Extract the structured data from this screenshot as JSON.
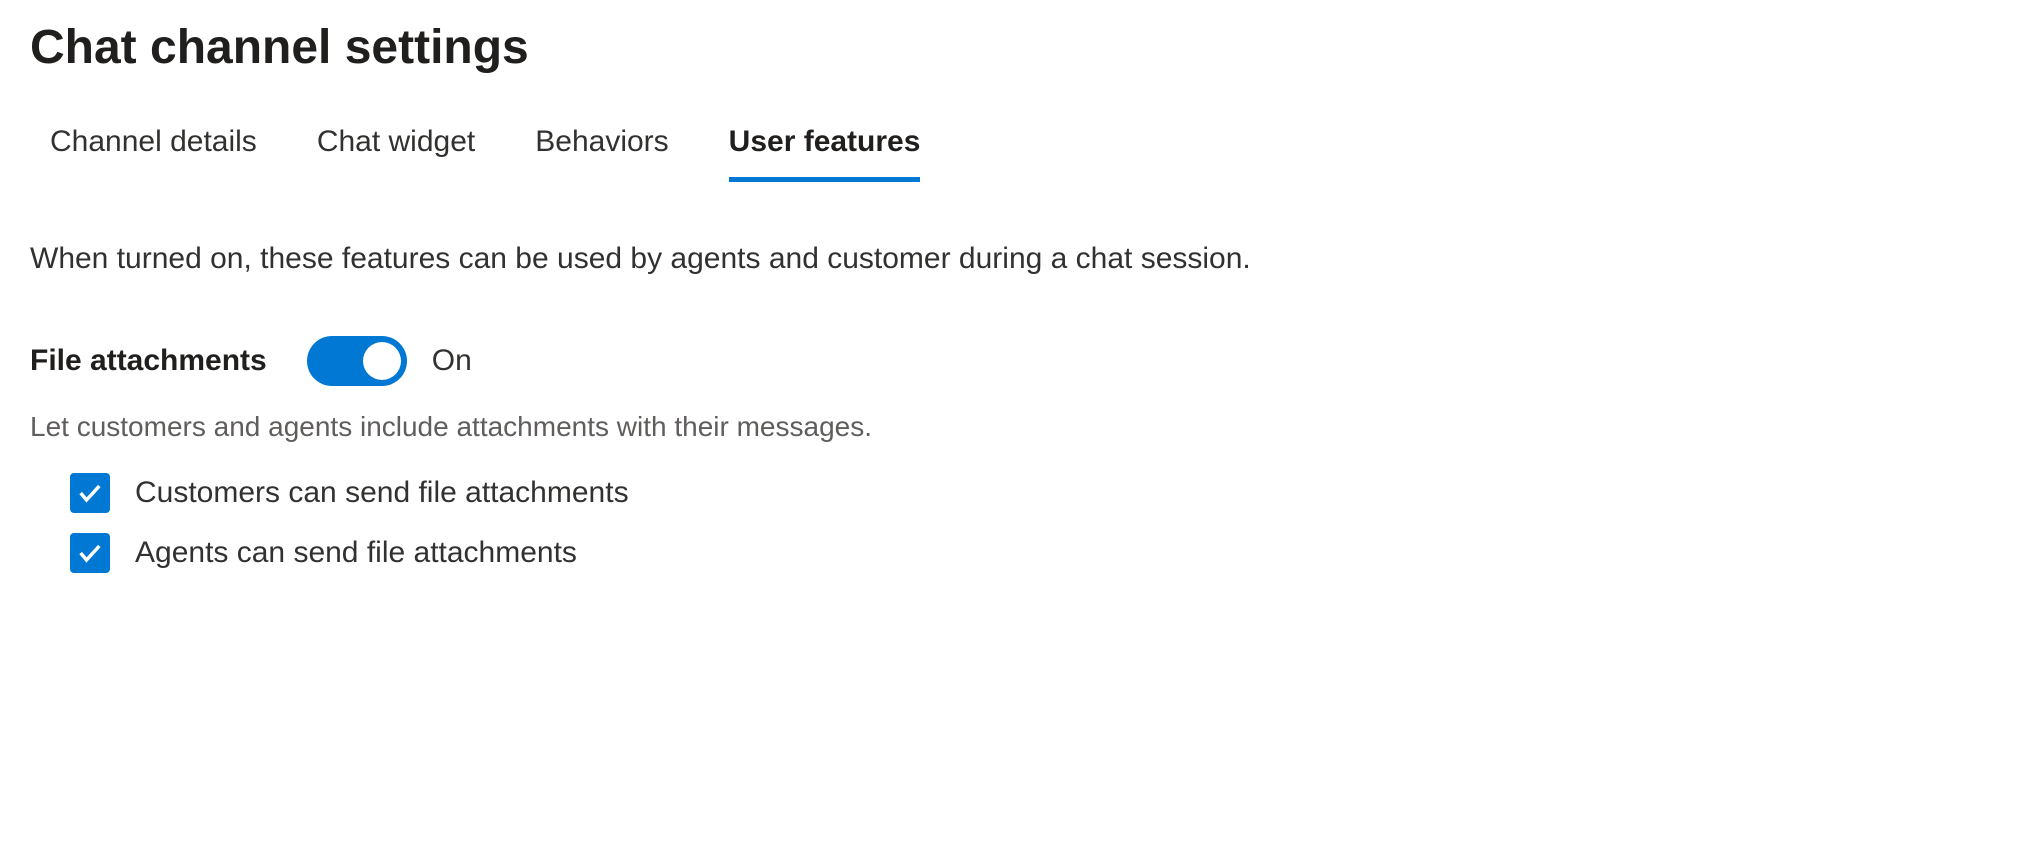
{
  "header": {
    "title": "Chat channel settings"
  },
  "tabs": [
    {
      "label": "Channel details",
      "active": false
    },
    {
      "label": "Chat widget",
      "active": false
    },
    {
      "label": "Behaviors",
      "active": false
    },
    {
      "label": "User features",
      "active": true
    }
  ],
  "description": "When turned on, these features can be used by agents and customer during a chat session.",
  "features": {
    "file_attachments": {
      "label": "File attachments",
      "toggle_state": "On",
      "toggle_on": true,
      "help_text": "Let customers and agents include attachments with their messages.",
      "options": [
        {
          "label": "Customers can send file attachments",
          "checked": true
        },
        {
          "label": "Agents can send file attachments",
          "checked": true
        }
      ]
    }
  }
}
